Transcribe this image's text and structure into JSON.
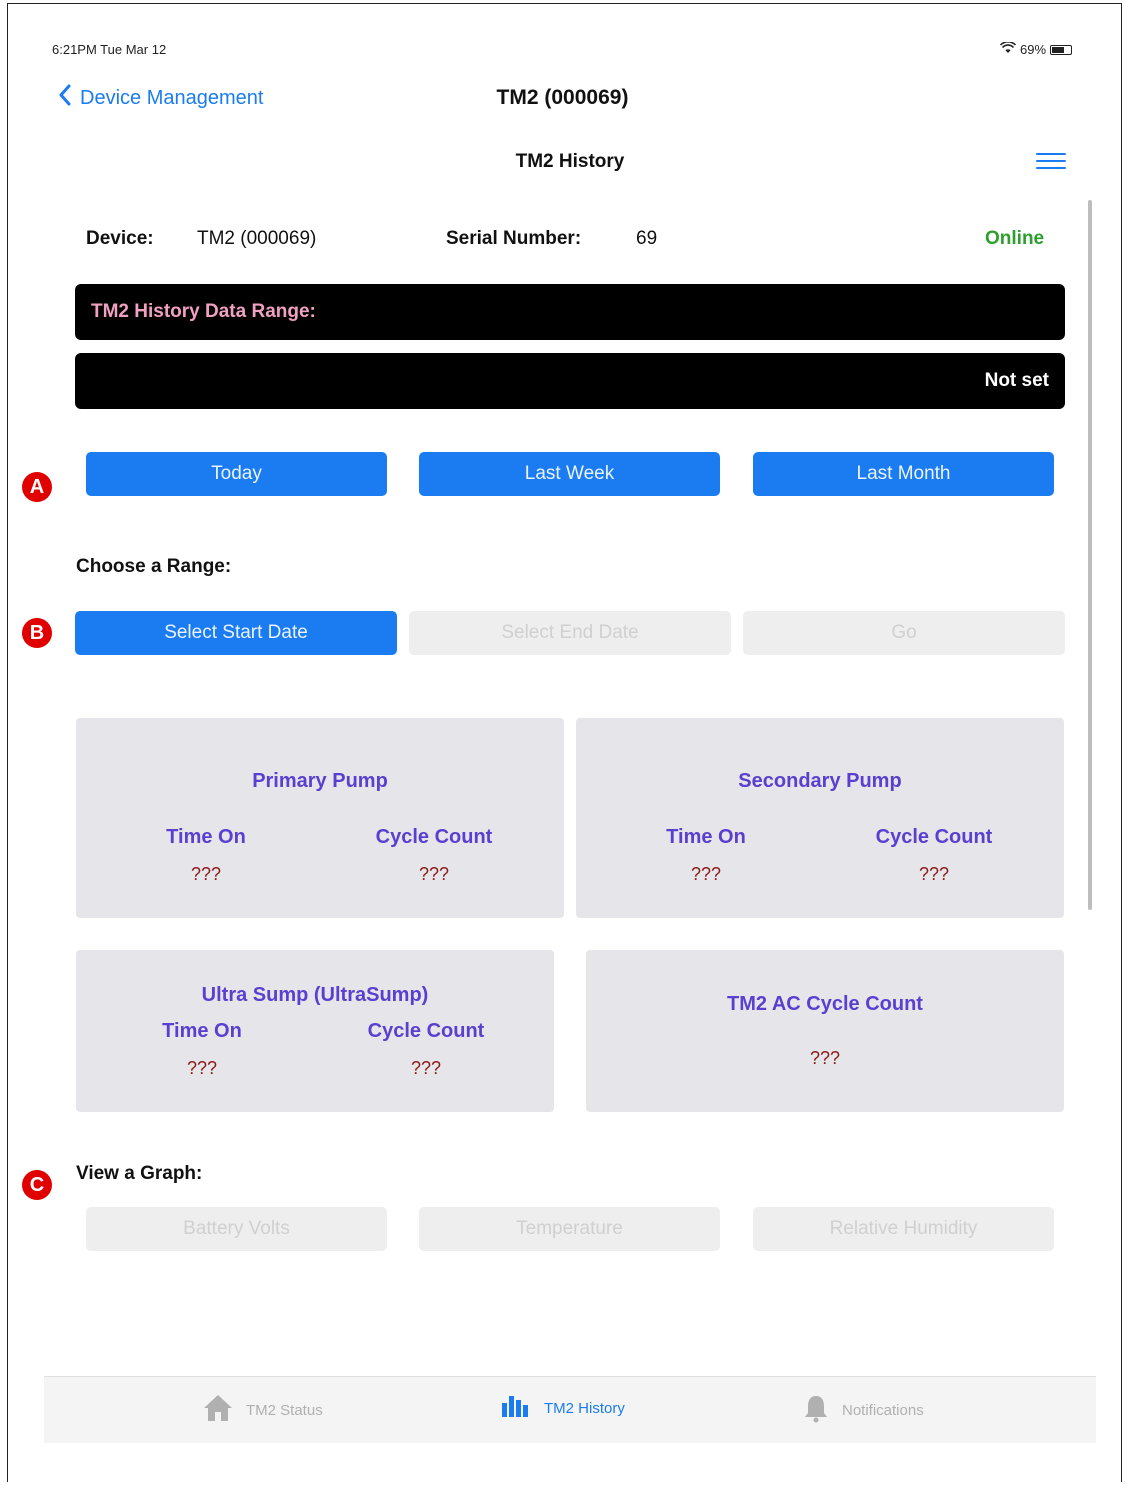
{
  "status_bar": {
    "time": "6:21PM  Tue Mar 12",
    "battery": "69%"
  },
  "nav": {
    "back_label": "Device Management",
    "title": "TM2 (000069)"
  },
  "page": {
    "subtitle": "TM2 History"
  },
  "device_info": {
    "device_label": "Device:",
    "device_value": "TM2 (000069)",
    "serial_label": "Serial Number:",
    "serial_value": "69",
    "status": "Online"
  },
  "data_range": {
    "label": "TM2 History Data Range:",
    "value": "Not set"
  },
  "quick_range": {
    "today": "Today",
    "last_week": "Last Week",
    "last_month": "Last Month"
  },
  "custom_range": {
    "heading": "Choose a Range:",
    "start": "Select Start Date",
    "end": "Select End Date",
    "go": "Go"
  },
  "cards": {
    "primary": {
      "title": "Primary Pump",
      "time_on_label": "Time On",
      "cycle_label": "Cycle Count",
      "time_on_value": "???",
      "cycle_value": "???"
    },
    "secondary": {
      "title": "Secondary Pump",
      "time_on_label": "Time On",
      "cycle_label": "Cycle Count",
      "time_on_value": "???",
      "cycle_value": "???"
    },
    "ultra": {
      "title": "Ultra Sump (UltraSump)",
      "time_on_label": "Time On",
      "cycle_label": "Cycle Count",
      "time_on_value": "???",
      "cycle_value": "???"
    },
    "ac": {
      "title": "TM2 AC Cycle Count",
      "value": "???"
    }
  },
  "graph": {
    "heading": "View a Graph:",
    "battery": "Battery Volts",
    "temperature": "Temperature",
    "humidity": "Relative Humidity"
  },
  "markers": {
    "a": "A",
    "b": "B",
    "c": "C"
  },
  "tabs": {
    "status": "TM2 Status",
    "history": "TM2 History",
    "notifications": "Notifications"
  },
  "colors": {
    "accent": "#1a7cf0",
    "online": "#2e9e2e",
    "card_title": "#5a3fd0",
    "value": "#8b1a1a",
    "marker": "#e00000"
  }
}
